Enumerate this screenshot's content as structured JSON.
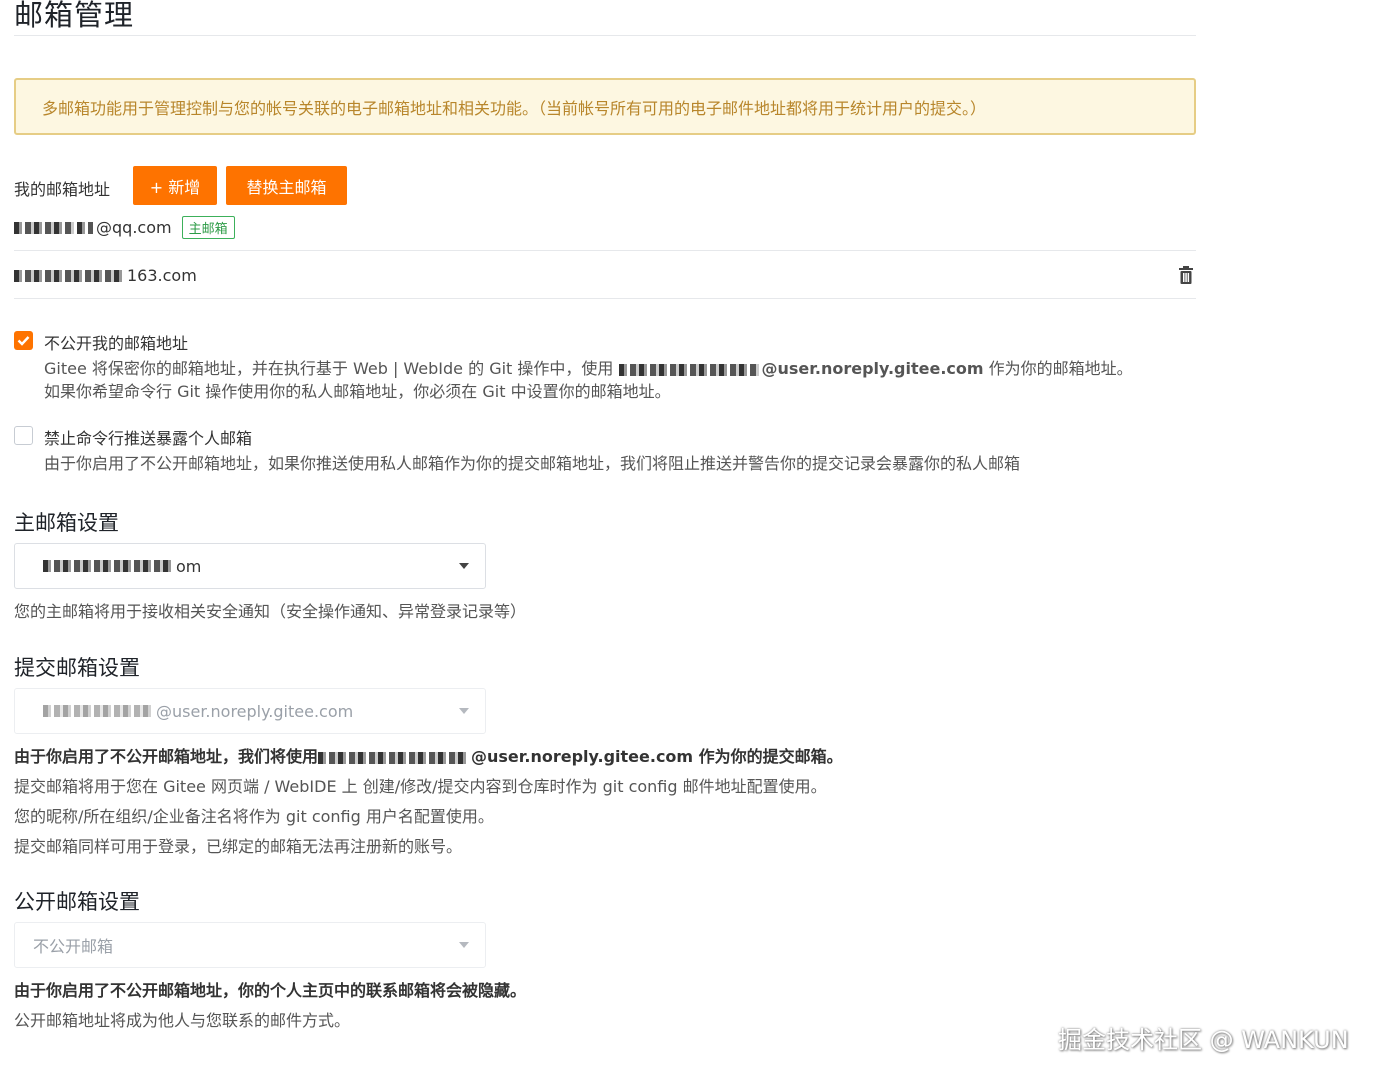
{
  "page": {
    "title": "邮箱管理",
    "notice": "多邮箱功能用于管理控制与您的帐号关联的电子邮箱地址和相关功能。（当前帐号所有可用的电子邮件地址都将用于统计用户的提交。）"
  },
  "addresses": {
    "label": "我的邮箱地址",
    "add_button": "+ 新增",
    "replace_button": "替换主邮箱",
    "emails": [
      {
        "visible_suffix": "@qq.com",
        "badge": "主邮箱"
      },
      {
        "visible_suffix": "163.com"
      }
    ]
  },
  "privacy": {
    "hide_email": {
      "checked": true,
      "title": "不公开我的邮箱地址",
      "desc_line1_pre": "Gitee 将保密你的邮箱地址，并在执行基于 Web | WebIde 的 Git 操作中，使用",
      "desc_line1_email": "@user.noreply.gitee.com",
      "desc_line1_post": " 作为你的邮箱地址。",
      "desc_line2": "如果你希望命令行 Git 操作使用你的私人邮箱地址，你必须在 Git 中设置你的邮箱地址。"
    },
    "block_push": {
      "checked": false,
      "title": "禁止命令行推送暴露个人邮箱",
      "desc": "由于你启用了不公开邮箱地址，如果你推送使用私人邮箱作为你的提交邮箱地址，我们将阻止推送并警告你的提交记录会暴露你的私人邮箱"
    }
  },
  "primary_email": {
    "title": "主邮箱设置",
    "selected_suffix": "om",
    "hint": "您的主邮箱将用于接收相关安全通知（安全操作通知、异常登录记录等）"
  },
  "commit_email": {
    "title": "提交邮箱设置",
    "selected_suffix": "@user.noreply.gitee.com",
    "hint_bold_pre": "由于你启用了不公开邮箱地址，我们将使用",
    "hint_bold_email": "@user.noreply.gitee.com",
    "hint_bold_post": " 作为你的提交邮箱。",
    "hint2": "提交邮箱将用于您在 Gitee 网页端 / WebIDE 上 创建/修改/提交内容到仓库时作为 git config 邮件地址配置使用。",
    "hint3": "您的昵称/所在组织/企业备注名将作为 git config 用户名配置使用。",
    "hint4": "提交邮箱同样可用于登录，已绑定的邮箱无法再注册新的账号。"
  },
  "public_email": {
    "title": "公开邮箱设置",
    "selected": "不公开邮箱",
    "hint_bold": "由于你启用了不公开邮箱地址，你的个人主页中的联系邮箱将会被隐藏。",
    "hint2": "公开邮箱地址将成为他人与您联系的邮件方式。"
  },
  "watermark": "掘金技术社区 @ WANKUN",
  "colors": {
    "accent": "#fe7300",
    "notice_bg": "#fdf7e1",
    "notice_text": "#b8862b",
    "badge_green": "#2c9b46"
  }
}
